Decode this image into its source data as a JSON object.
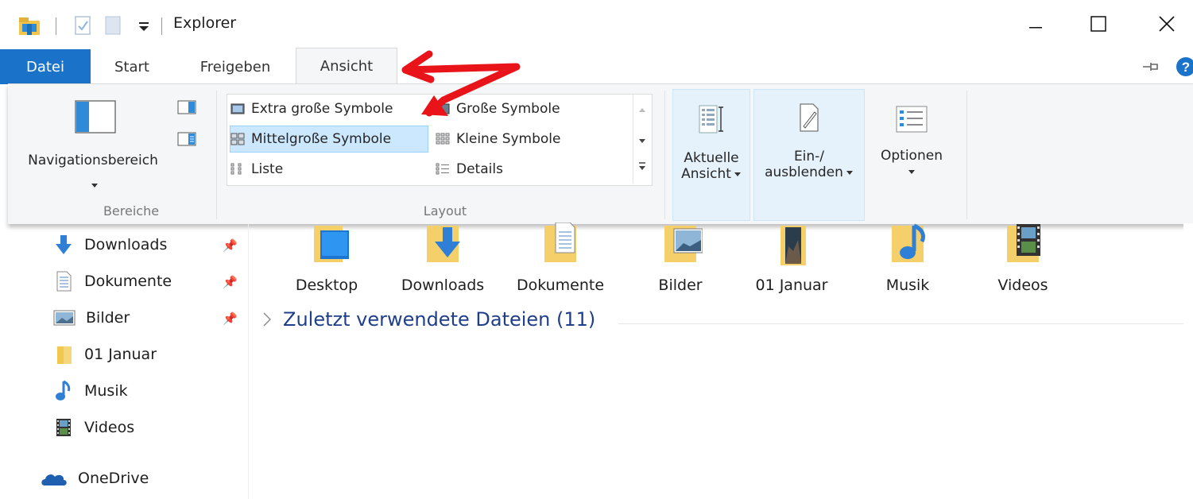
{
  "window": {
    "title": "Explorer",
    "minimize_icon": "minimize-icon",
    "maximize_icon": "maximize-icon",
    "close_icon": "close-icon"
  },
  "ribbon_tabs": [
    {
      "label": "Datei"
    },
    {
      "label": "Start"
    },
    {
      "label": "Freigeben"
    },
    {
      "label": "Ansicht"
    }
  ],
  "ribbon": {
    "panes": {
      "nav_pane_label": "Navigationsbereich",
      "group_label": "Bereiche"
    },
    "layout": {
      "items": [
        {
          "label": "Extra große Symbole"
        },
        {
          "label": "Große Symbole"
        },
        {
          "label": "Mittelgroße Symbole",
          "selected": true
        },
        {
          "label": "Kleine Symbole"
        },
        {
          "label": "Liste"
        },
        {
          "label": "Details"
        }
      ],
      "group_label": "Layout"
    },
    "current_view": {
      "line1": "Aktuelle",
      "line2": "Ansicht"
    },
    "show_hide": {
      "line1": "Ein-/",
      "line2": "ausblenden"
    },
    "options": {
      "label": "Optionen"
    }
  },
  "nav_pane": {
    "items": [
      {
        "label": "Downloads",
        "icon": "download-arrow-icon",
        "pinned": true
      },
      {
        "label": "Dokumente",
        "icon": "document-icon",
        "pinned": true
      },
      {
        "label": "Bilder",
        "icon": "picture-icon",
        "pinned": true
      },
      {
        "label": "01 Januar",
        "icon": "folder-icon",
        "pinned": false
      },
      {
        "label": "Musik",
        "icon": "music-note-icon",
        "pinned": false
      },
      {
        "label": "Videos",
        "icon": "film-icon",
        "pinned": false
      }
    ],
    "onedrive": {
      "label": "OneDrive"
    }
  },
  "content": {
    "folders": [
      {
        "label": "Desktop"
      },
      {
        "label": "Downloads"
      },
      {
        "label": "Dokumente"
      },
      {
        "label": "Bilder"
      },
      {
        "label": "01 Januar"
      },
      {
        "label": "Musik"
      },
      {
        "label": "Videos"
      }
    ],
    "recent_header": "Zuletzt verwendete Dateien (11)"
  },
  "colors": {
    "file_tab": "#1a72c9",
    "ribbon_bg": "#f5f6f7",
    "selection": "#cce8ff",
    "folder": "#f0c850",
    "annotation_arrow": "#e8141a"
  }
}
